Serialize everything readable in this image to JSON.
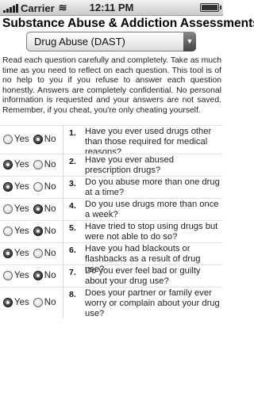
{
  "status_bar": {
    "carrier": "Carrier",
    "time": "12:11 PM"
  },
  "header": {
    "title": "Substance Abuse & Addiction Assessments"
  },
  "assessment_selector": {
    "selected": "Drug Abuse (DAST)"
  },
  "intro_text": "Read each question carefully and completely. Take as much time as you need to reflect on each question. This tool is of no help to you if you refuse to answer each question honestly. Answers are completely confidential. No personal information is requested and your answers are not saved. Remember, if you cheat, you're only cheating yourself.",
  "answer_labels": {
    "yes": "Yes",
    "no": "No"
  },
  "questions": [
    {
      "number": "1.",
      "text": "Have you ever used drugs other than those required for medical reasons?",
      "answer": "no"
    },
    {
      "number": "2.",
      "text": "Have you ever abused prescription drugs?",
      "answer": "yes"
    },
    {
      "number": "3.",
      "text": "Do you abuse more than one drug at a time?",
      "answer": "yes"
    },
    {
      "number": "4.",
      "text": "Do you use drugs more than once a week?",
      "answer": "no"
    },
    {
      "number": "5.",
      "text": "Have tried to stop using drugs but were not able to do so?",
      "answer": "no"
    },
    {
      "number": "6.",
      "text": "Have you had blackouts or flashbacks as a result of drug use?",
      "answer": "yes"
    },
    {
      "number": "7.",
      "text": "Do you ever feel bad or guilty about your drug use?",
      "answer": "no"
    },
    {
      "number": "8.",
      "text": "Does your partner or family ever worry or complain about your drug use?",
      "answer": "yes"
    }
  ]
}
